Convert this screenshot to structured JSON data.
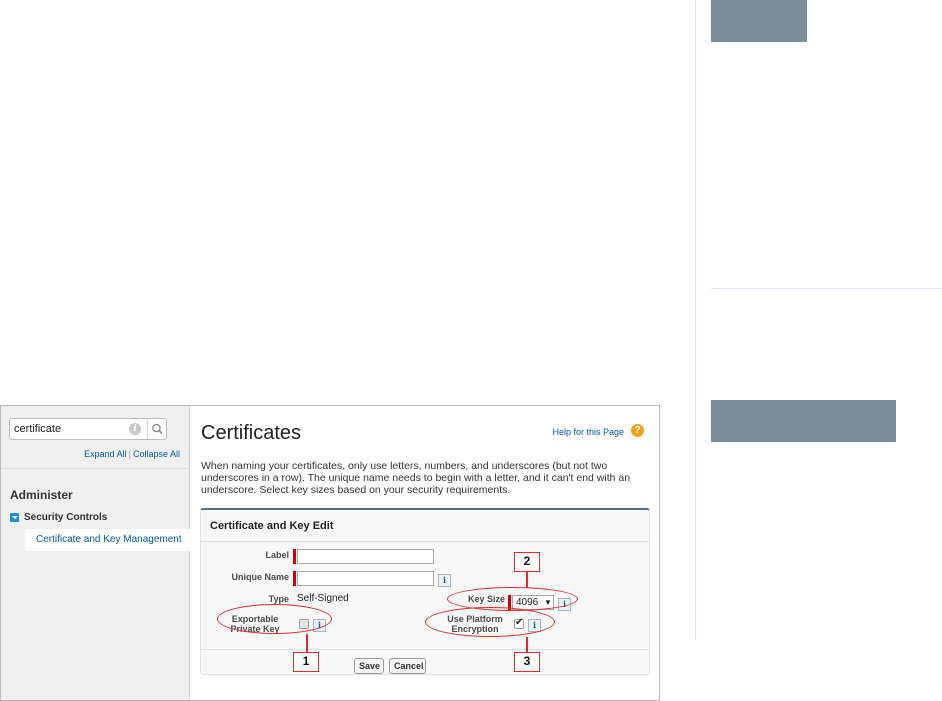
{
  "colors": {
    "deco_block": "#7a8f9a",
    "accent_link": "#015ba7",
    "required": "#cc0000",
    "callout": "#d9302c",
    "help_icon": "#f3a31b"
  },
  "sidebar": {
    "search": {
      "value": "certificate",
      "placeholder": ""
    },
    "expand_all": "Expand All",
    "separator": "|",
    "collapse_all": "Collapse All",
    "section_title": "Administer",
    "group_label": "Security Controls",
    "selected_item": "Certificate and Key Management"
  },
  "main": {
    "title": "Certificates",
    "help_link": "Help for this Page",
    "help_icon_glyph": "?",
    "intro": "When naming your certificates, only use letters, numbers, and underscores (but not two underscores in a row). The unique name needs to begin with a letter, and it can't end with an underscore. Select key sizes based on your security requirements.",
    "panel": {
      "title": "Certificate and Key Edit",
      "label_label": "Label",
      "label_value": "",
      "unique_name_label": "Unique Name",
      "unique_name_value": "",
      "type_label": "Type",
      "type_value": "Self-Signed",
      "key_size_label": "Key Size",
      "key_size_value": "4096",
      "key_size_arrow": "▼",
      "exportable_line1": "Exportable",
      "exportable_line2": "Private Key",
      "exportable_checked": false,
      "platform_line1": "Use Platform",
      "platform_line2": "Encryption",
      "platform_checked": true,
      "info_glyph": "i",
      "save": "Save",
      "cancel": "Cancel"
    }
  },
  "callouts": {
    "one": "1",
    "two": "2",
    "three": "3"
  }
}
